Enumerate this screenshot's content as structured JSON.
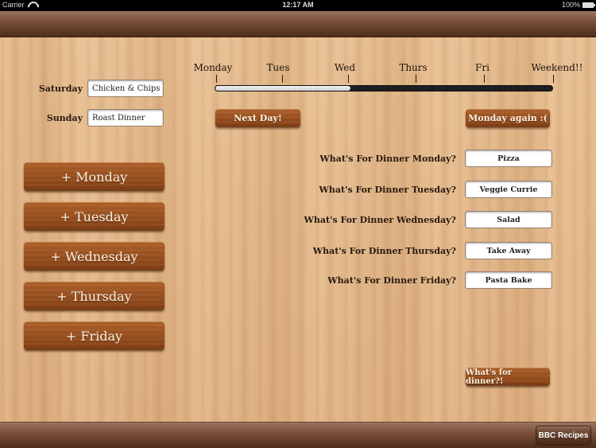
{
  "status_bar": {
    "carrier": "Carrier",
    "time": "12:17 AM",
    "battery": "100%"
  },
  "weekend": {
    "saturday_label": "Saturday",
    "saturday_value": "Chicken & Chips",
    "sunday_label": "Sunday",
    "sunday_value": "Roast Dinner"
  },
  "week_progress": {
    "days": [
      "Monday",
      "Tues",
      "Wed",
      "Thurs",
      "Fri",
      "Weekend!!"
    ],
    "progress_fraction": 0.4,
    "current_day": "Wed"
  },
  "buttons": {
    "next_day": "Next Day!",
    "monday_again": "Monday again :(",
    "whats_for_dinner": "What's for dinner?!",
    "bbc_recipes": "BBC Recipes"
  },
  "add_day_buttons": [
    "+ Monday",
    "+ Tuesday",
    "+ Wednesday",
    "+ Thursday",
    "+ Friday"
  ],
  "dinners": [
    {
      "question": "What's For Dinner Monday?",
      "value": "Pizza"
    },
    {
      "question": "What's For Dinner Tuesday?",
      "value": "Veggie Currie"
    },
    {
      "question": "What's For Dinner Wednesday?",
      "value": "Salad"
    },
    {
      "question": "What's For Dinner Thursday?",
      "value": "Take Away"
    },
    {
      "question": "What's For Dinner Friday?",
      "value": "Pasta Bake"
    }
  ]
}
